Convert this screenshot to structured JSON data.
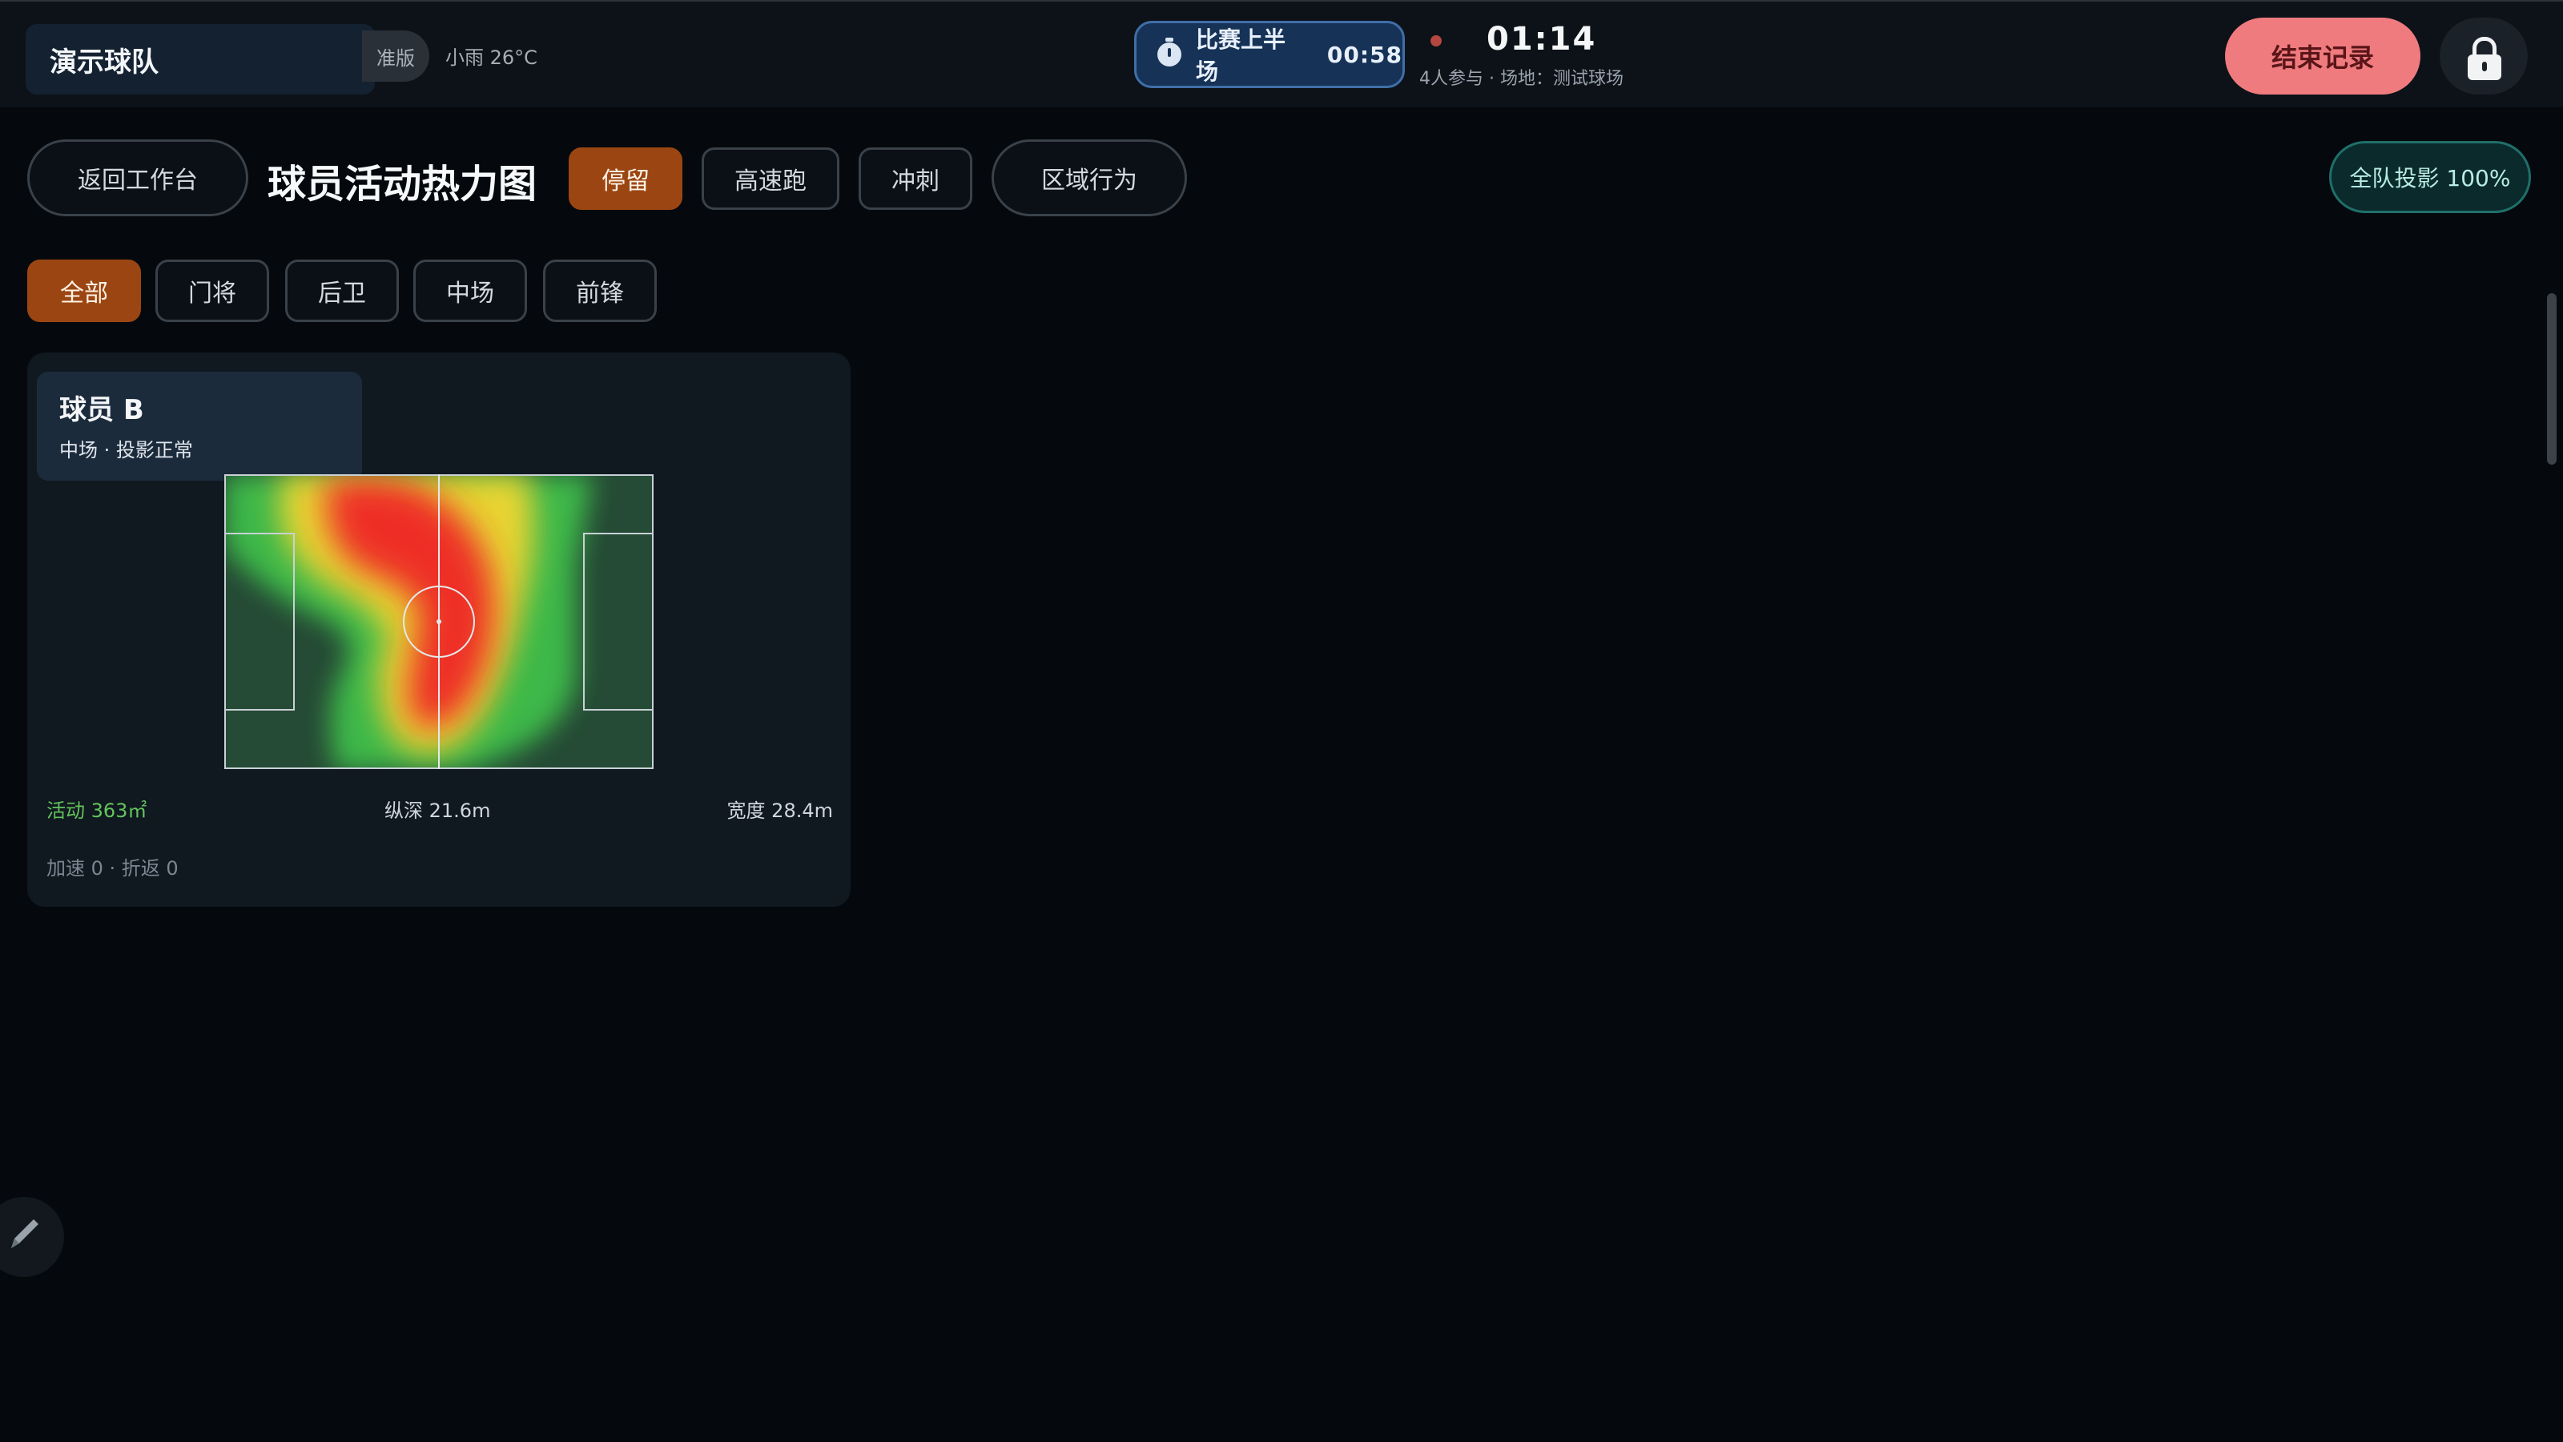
{
  "topbar": {
    "team_name": "演示球队",
    "edition_badge": "准版",
    "weather": "小雨 26°C",
    "match_phase": "比赛上半场",
    "match_timer": "00:58",
    "clock": "01:14",
    "clock_sub": "4人参与 · 场地：测试球场",
    "end_button": "结束记录",
    "icons": [
      "stopwatch-icon",
      "recording-dot-icon",
      "lock-icon"
    ]
  },
  "toolbar": {
    "back_button": "返回工作台",
    "title": "球员活动热力图",
    "modes": [
      "停留",
      "高速跑",
      "冲刺",
      "区域行为"
    ],
    "active_mode": "停留",
    "projection_button": "全队投影 100%"
  },
  "position_filters": {
    "items": [
      "全部",
      "门将",
      "后卫",
      "中场",
      "前锋"
    ],
    "active": "全部"
  },
  "player_card": {
    "name": "球员 B",
    "subtitle": "中场 · 投影正常",
    "activity_area": "活动 363㎡",
    "depth": "纵深 21.6m",
    "width": "宽度 28.4m",
    "extra": "加速 0 · 折返 0",
    "heatmap_colors": {
      "pitch": "#254a35",
      "low": "#3db84a",
      "mid": "#e8d430",
      "high": "#ee2f28"
    }
  },
  "colors": {
    "accent": "#9b4612",
    "end_button": "#ef7b7f",
    "timer_pill": "#163257",
    "projection": "#0b2a2c"
  }
}
